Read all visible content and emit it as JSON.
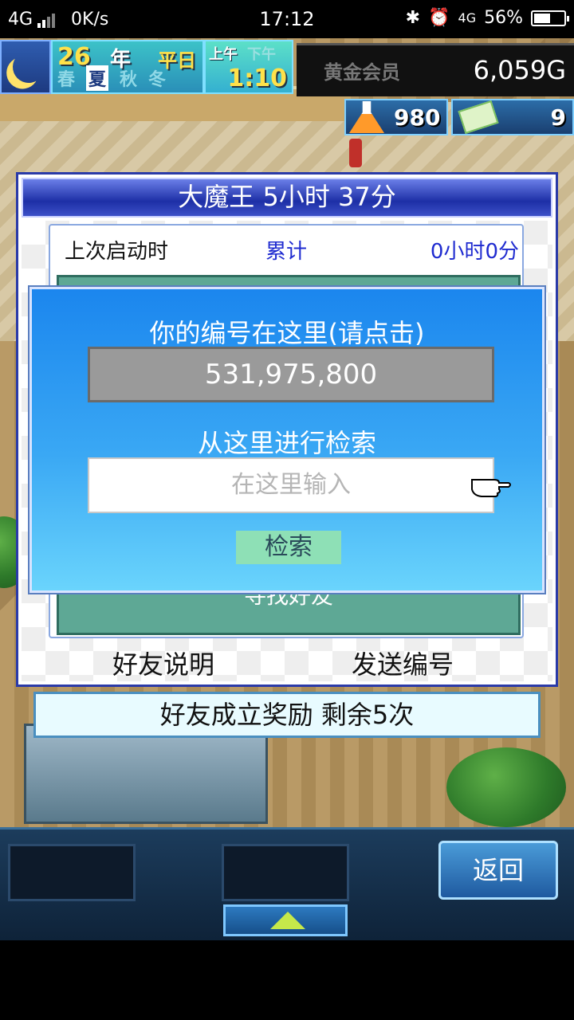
{
  "status_bar": {
    "network": "4G",
    "speed": "0K/s",
    "time": "17:12",
    "network2": "4G",
    "battery": "56%",
    "battery_level": 0.56
  },
  "hud": {
    "year": "26",
    "year_unit": "年",
    "day_type": "平日",
    "seasons": [
      "春",
      "夏",
      "秋",
      "冬"
    ],
    "active_season": "夏",
    "am": "上午",
    "pm": "下午",
    "clock": "1:10",
    "membership": "黄金会员",
    "gold": "6,059G",
    "research_points": "980",
    "tickets": "9"
  },
  "panel": {
    "title": "大魔王  5小时 37分",
    "last_launch_label": "上次启动时",
    "total_label": "累计",
    "total_value": "0小时0分",
    "find_friend": "寻找好友",
    "friend_help_button": "好友说明",
    "send_id_button": "发送编号"
  },
  "dialog": {
    "title": "你的编号在这里(请点击)",
    "user_id": "531,975,800",
    "search_title": "从这里进行检索",
    "search_placeholder": "在这里输入",
    "search_button": "检索"
  },
  "reward": {
    "text": "好友成立奖励  剩余5次"
  },
  "bottom": {
    "back_button": "返回"
  }
}
